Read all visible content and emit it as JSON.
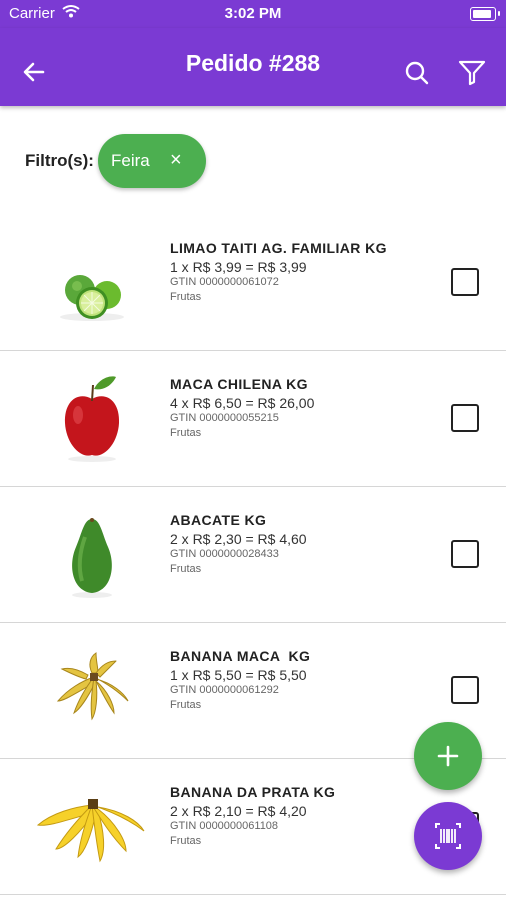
{
  "status_bar": {
    "carrier": "Carrier",
    "time": "3:02 PM"
  },
  "app_bar": {
    "title": "Pedido #288"
  },
  "filters": {
    "label": "Filtro(s):",
    "chips": [
      {
        "label": "Feira",
        "remove_icon": "×"
      }
    ]
  },
  "items": [
    {
      "name": "LIMAO TAITI AG. FAMILIAR KG",
      "calc": "1 x R$ 3,99 = R$ 3,99",
      "gtin": "GTIN 0000000061072",
      "category": "Frutas",
      "image": "lime-image",
      "checked": false
    },
    {
      "name": "MACA CHILENA KG",
      "calc": "4 x R$ 6,50 = R$ 26,00",
      "gtin": "GTIN 0000000055215",
      "category": "Frutas",
      "image": "apple-image",
      "checked": false
    },
    {
      "name": "ABACATE KG",
      "calc": "2 x R$ 2,30 = R$ 4,60",
      "gtin": "GTIN 0000000028433",
      "category": "Frutas",
      "image": "avocado-image",
      "checked": false
    },
    {
      "name": "BANANA MACA  KG",
      "calc": "1 x R$ 5,50 = R$ 5,50",
      "gtin": "GTIN 0000000061292",
      "category": "Frutas",
      "image": "banana-maca-image",
      "checked": false
    },
    {
      "name": "BANANA DA PRATA KG",
      "calc": "2 x R$ 2,10 = R$ 4,20",
      "gtin": "GTIN 0000000061108",
      "category": "Frutas",
      "image": "banana-prata-image",
      "checked": false
    }
  ],
  "colors": {
    "primary": "#7b3ad3",
    "accent_green": "#4caf50"
  },
  "icons": {
    "back": "arrow-left-icon",
    "search": "search-icon",
    "filter": "filter-icon",
    "add": "plus-icon",
    "scan": "barcode-icon",
    "wifi": "wifi-icon",
    "battery": "battery-icon"
  }
}
